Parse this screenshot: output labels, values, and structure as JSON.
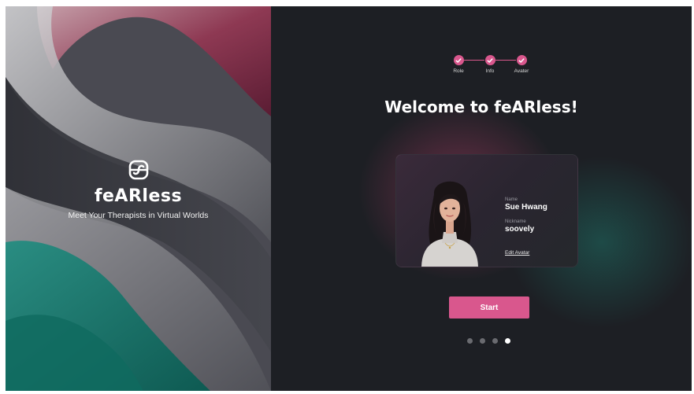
{
  "brand": {
    "name": "feARless",
    "tagline": "Meet Your Therapists in Virtual Worlds"
  },
  "stepper": {
    "steps": [
      {
        "label": "Role",
        "completed": true
      },
      {
        "label": "Info",
        "completed": true
      },
      {
        "label": "Avater",
        "completed": true
      }
    ]
  },
  "main": {
    "title": "Welcome to feARless!",
    "profile": {
      "name_label": "Name",
      "name_value": "Sue Hwang",
      "nickname_label": "Nickname",
      "nickname_value": "soovely",
      "edit_link": "Edit Avatar"
    },
    "start_label": "Start"
  },
  "pagination": {
    "total": 4,
    "active_index": 3
  },
  "colors": {
    "accent": "#d9578d",
    "panel_dark": "#1d1f24",
    "brand_pink": "#8a2f4d",
    "brand_teal": "#1c7b70"
  }
}
